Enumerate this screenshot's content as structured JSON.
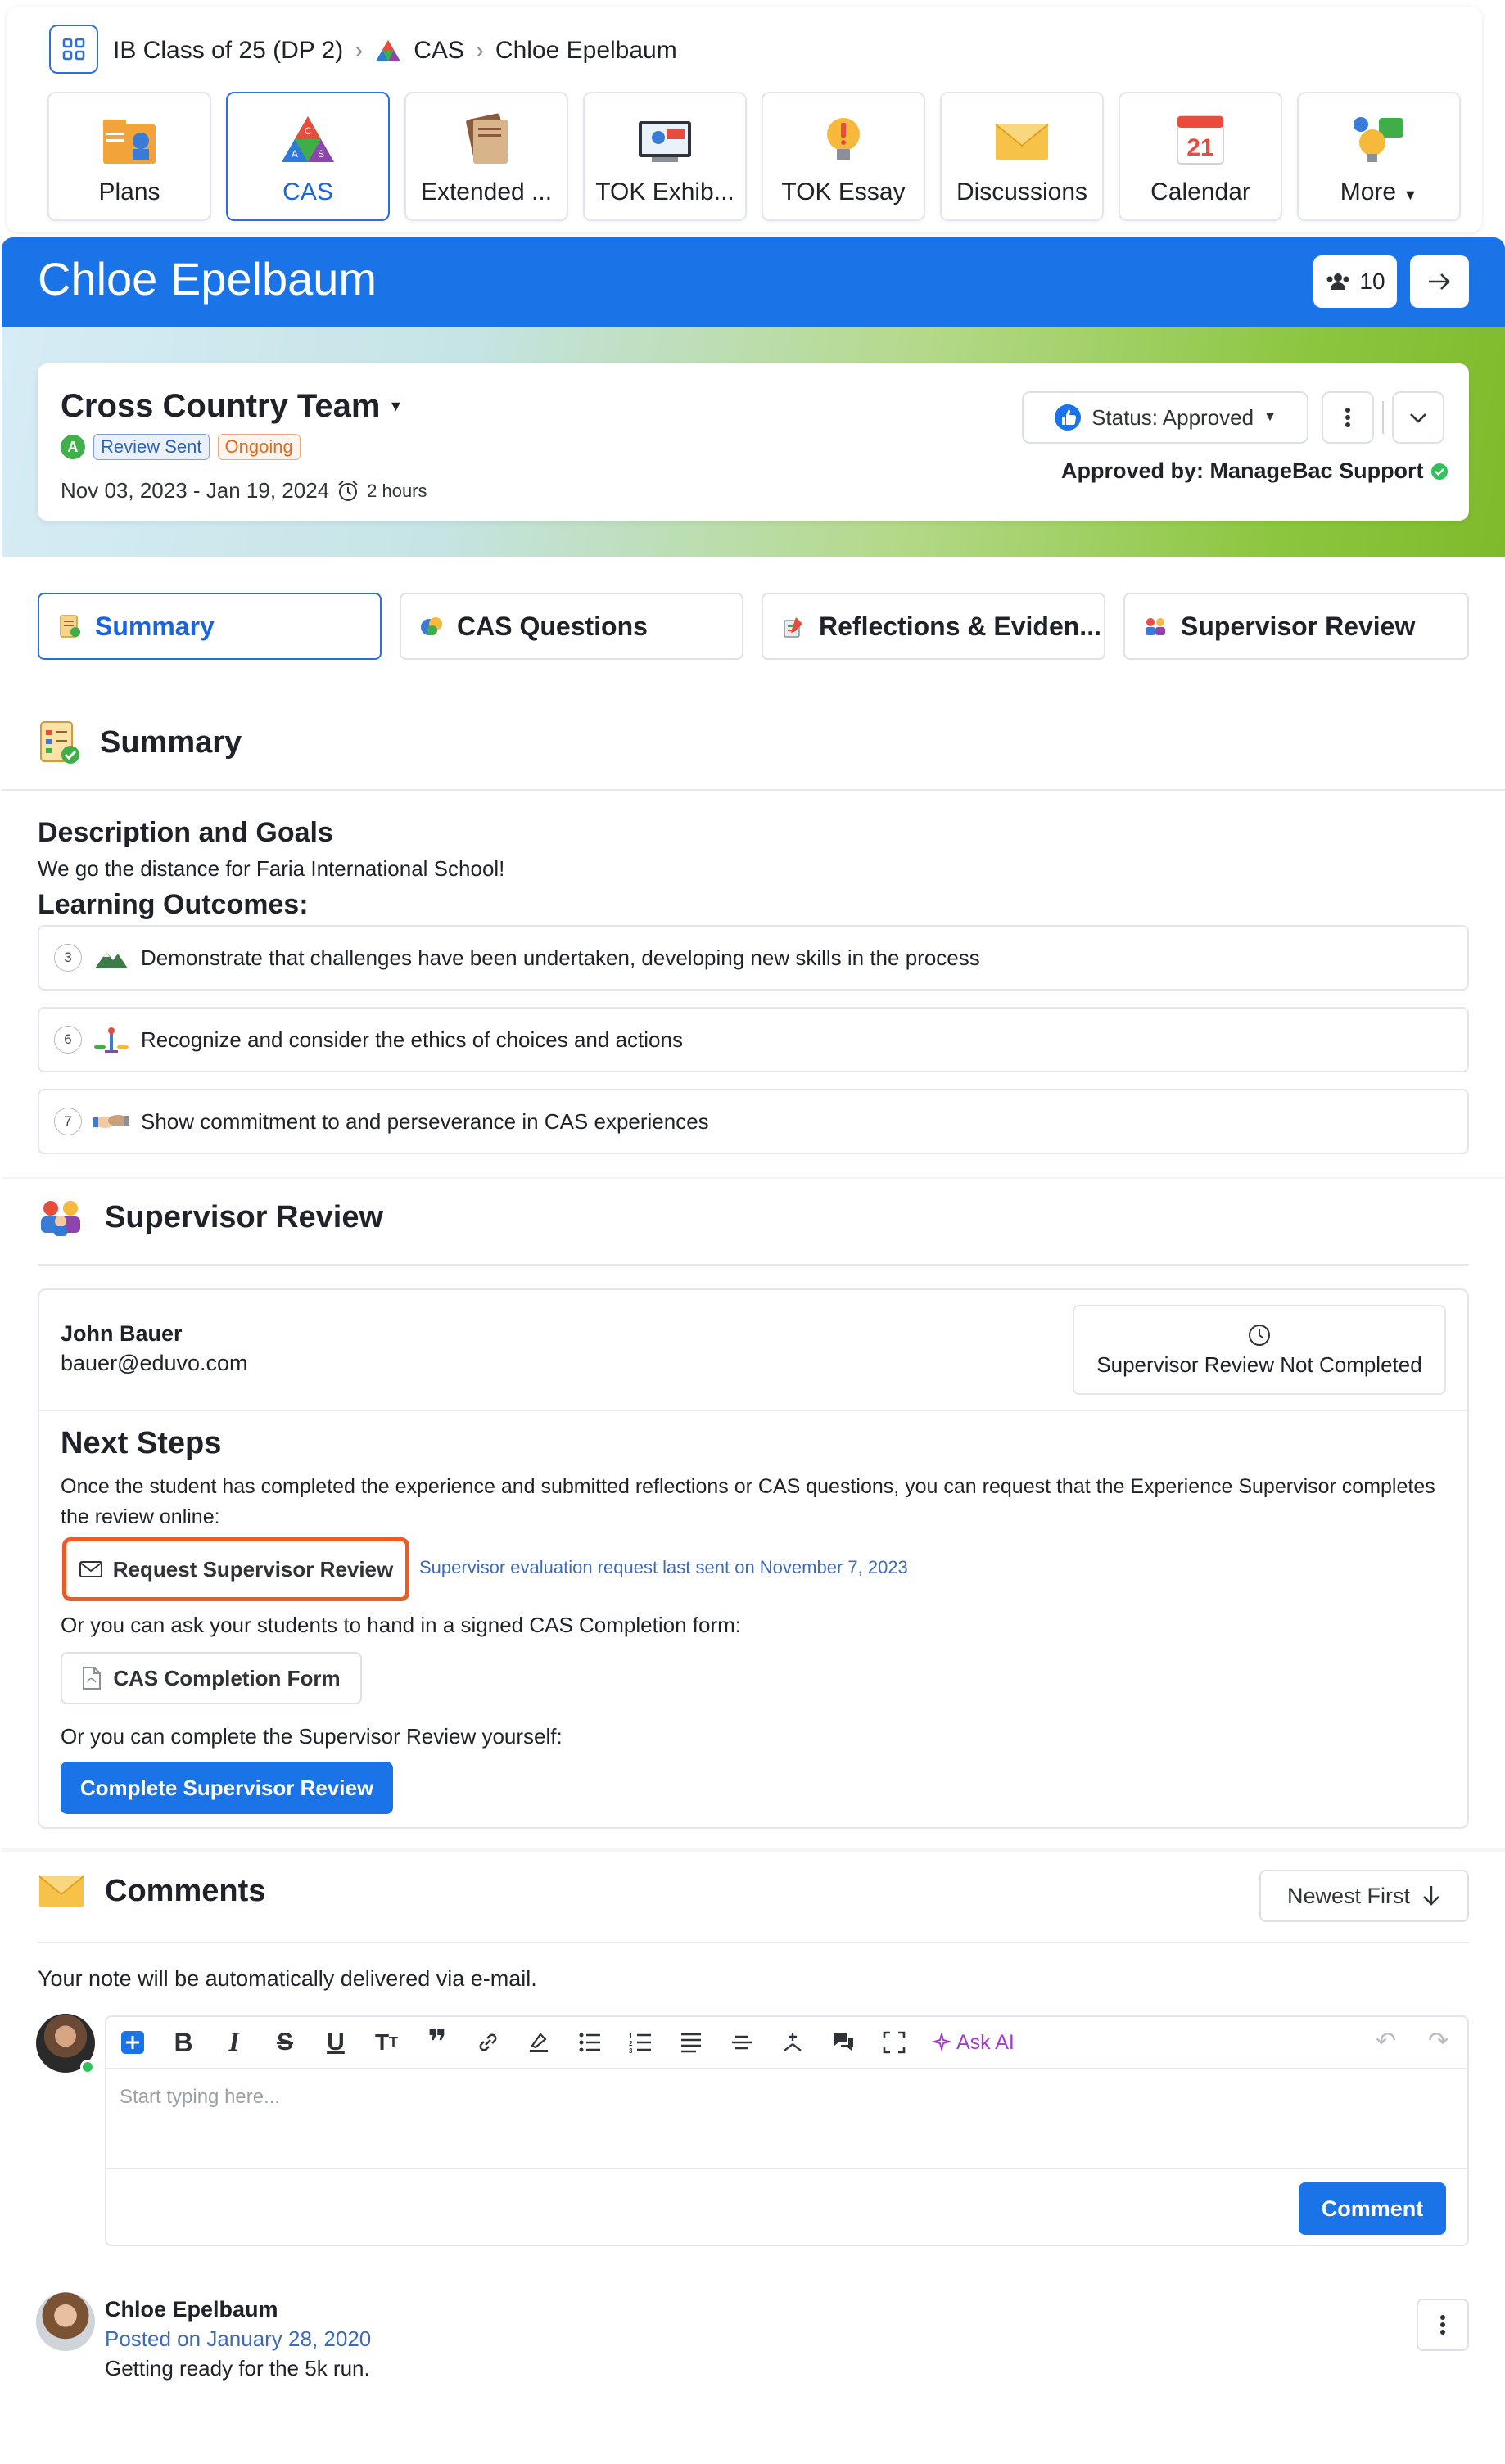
{
  "breadcrumb": {
    "class": "IB Class of 25 (DP 2)",
    "section": "CAS",
    "student": "Chloe Epelbaum"
  },
  "nav_tiles": [
    {
      "label": "Plans",
      "icon": "plans-icon"
    },
    {
      "label": "CAS",
      "icon": "cas-icon",
      "active": true
    },
    {
      "label": "Extended ...",
      "icon": "extended-essay-icon"
    },
    {
      "label": "TOK Exhib...",
      "icon": "tok-exhibition-icon"
    },
    {
      "label": "TOK Essay",
      "icon": "tok-essay-icon"
    },
    {
      "label": "Discussions",
      "icon": "discussions-icon"
    },
    {
      "label": "Calendar",
      "icon": "calendar-icon",
      "day": "21"
    },
    {
      "label": "More",
      "icon": "more-icon"
    }
  ],
  "banner": {
    "student_name": "Chloe Epelbaum",
    "count": "10",
    "color": "#1b73e8"
  },
  "experience": {
    "title": "Cross Country Team",
    "badge_letter": "A",
    "tags": [
      "Review Sent",
      "Ongoing"
    ],
    "dates": "Nov 03, 2023 - Jan 19, 2024",
    "hours": "2 hours",
    "status": "Status: Approved",
    "approved_by": "Approved by: ManageBac Support"
  },
  "tabs": [
    "Summary",
    "CAS Questions",
    "Reflections & Eviden...",
    "Supervisor Review"
  ],
  "summary": {
    "title": "Summary",
    "desc_heading": "Description and Goals",
    "desc_text": "We go the distance for Faria International School!",
    "lo_heading": "Learning Outcomes:",
    "outcomes": [
      {
        "num": "3",
        "text": "Demonstrate that challenges have been undertaken, developing new skills in the process"
      },
      {
        "num": "6",
        "text": "Recognize and consider the ethics of choices and actions"
      },
      {
        "num": "7",
        "text": "Show commitment to and perseverance in CAS experiences"
      }
    ]
  },
  "supervisor": {
    "title": "Supervisor Review",
    "name": "John Bauer",
    "email": "bauer@eduvo.com",
    "status": "Supervisor Review Not Completed",
    "next_heading": "Next Steps",
    "next_text": "Once the student has completed the experience and submitted reflections or CAS questions, you can request that the Experience Supervisor completes the review online:",
    "request_label": "Request Supervisor Review",
    "request_note": "Supervisor evaluation request last sent on November 7, 2023",
    "or1": "Or you can ask your students to hand in a signed CAS Completion form:",
    "form_label": "CAS Completion Form",
    "or2": "Or you can complete the Supervisor Review yourself:",
    "complete_label": "Complete Supervisor Review"
  },
  "comments": {
    "title": "Comments",
    "sort_label": "Newest First",
    "note": "Your note will be automatically delivered via e-mail.",
    "ask_ai": "Ask AI",
    "placeholder": "Start typing here...",
    "submit_label": "Comment",
    "items": [
      {
        "author": "Chloe Epelbaum",
        "date": "Posted on January 28, 2020",
        "text": "Getting ready for the 5k run."
      }
    ]
  }
}
